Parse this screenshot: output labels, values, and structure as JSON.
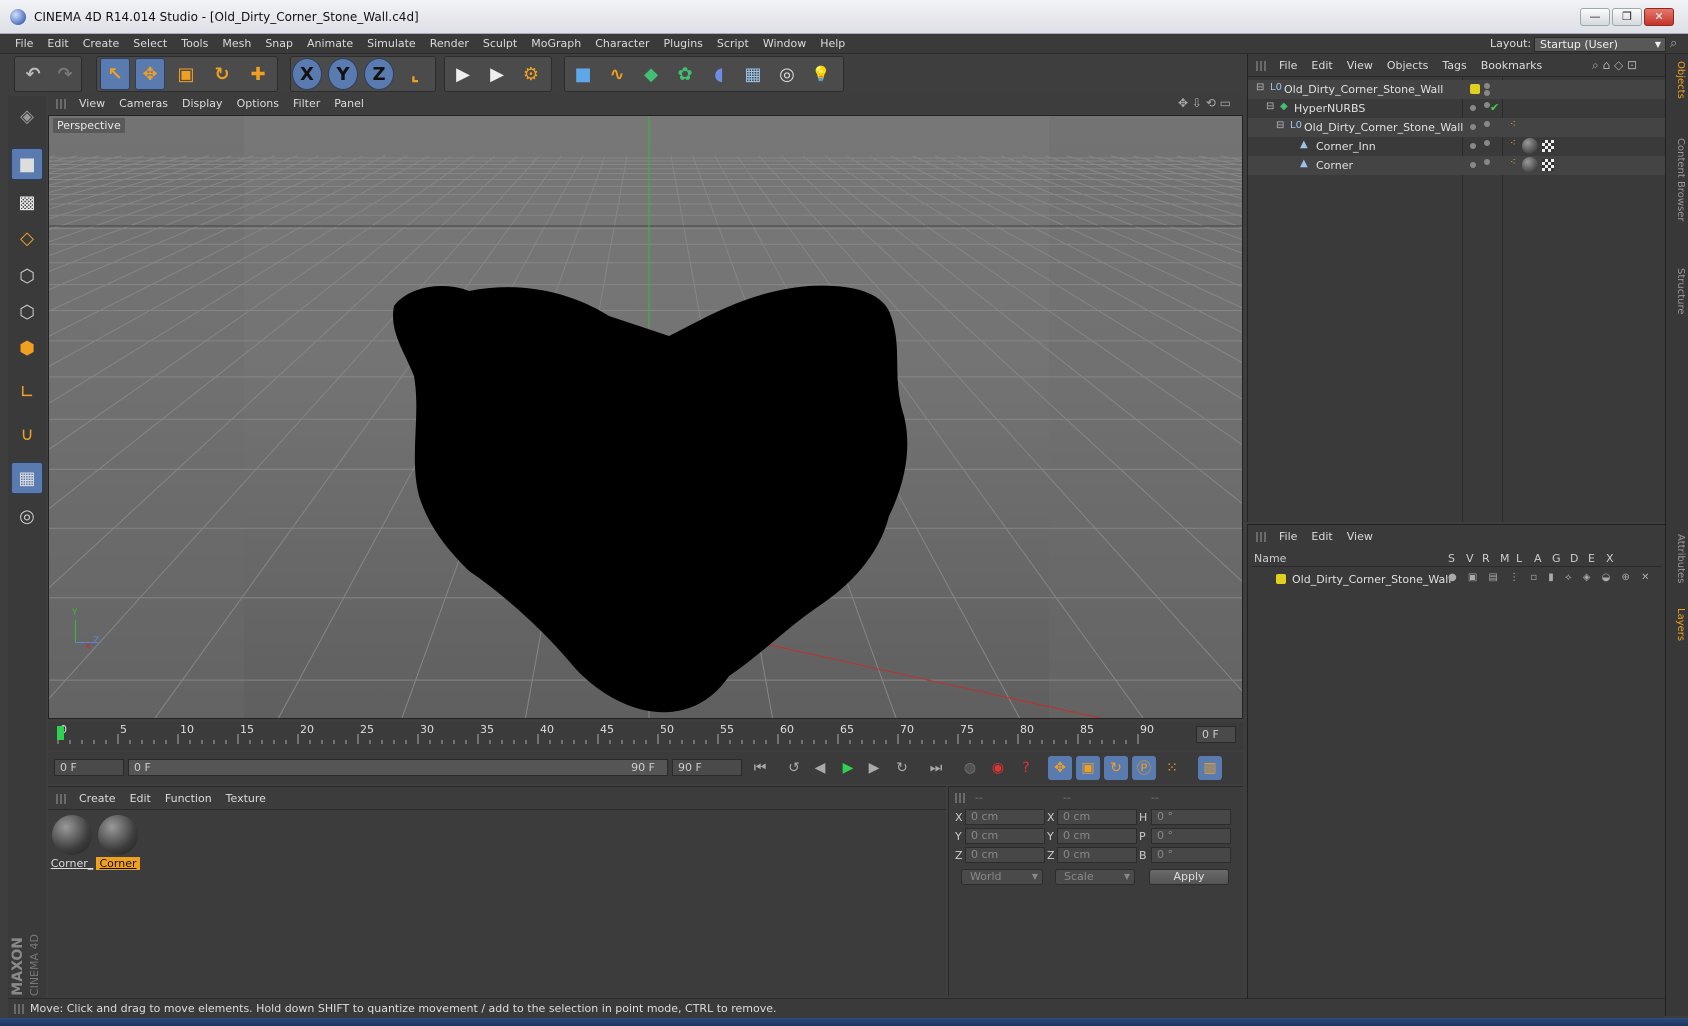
{
  "window": {
    "title": "CINEMA 4D R14.014 Studio - [Old_Dirty_Corner_Stone_Wall.c4d]",
    "minimize": "—",
    "restore": "❐",
    "close": "✕"
  },
  "menubar": {
    "items": [
      "File",
      "Edit",
      "Create",
      "Select",
      "Tools",
      "Mesh",
      "Snap",
      "Animate",
      "Simulate",
      "Render",
      "Sculpt",
      "MoGraph",
      "Character",
      "Plugins",
      "Script",
      "Window",
      "Help"
    ],
    "layout_label": "Layout:",
    "layout_value": "Startup (User)"
  },
  "toolbar": {
    "undo": "↶",
    "redo": "↷",
    "live_select": "↖",
    "move": "✥",
    "scale": "▣",
    "rotate": "↻",
    "add": "✚",
    "x_axis": "X",
    "y_axis": "Y",
    "z_axis": "Z",
    "coord_system": "⌞",
    "render_view": "▶",
    "render_pv": "▶",
    "render_settings": "⚙",
    "cube": "■",
    "spline": "∿",
    "nurbs": "◆",
    "array": "✿",
    "deformer": "◖",
    "scene": "▦",
    "camera": "◎",
    "light": "💡"
  },
  "viewport": {
    "menu": [
      "View",
      "Cameras",
      "Display",
      "Options",
      "Filter",
      "Panel"
    ],
    "camera_label": "Perspective",
    "axis_y": "Y",
    "axis_z": "Z",
    "axis_x": "X"
  },
  "timeline": {
    "ticks": [
      "0",
      "5",
      "10",
      "15",
      "20",
      "25",
      "30",
      "35",
      "40",
      "45",
      "50",
      "55",
      "60",
      "65",
      "70",
      "75",
      "80",
      "85",
      "90"
    ],
    "current_frame": "0 F",
    "start_frame": "0 F",
    "range_start": "0 F",
    "range_end": "90 F",
    "end_frame": "90 F"
  },
  "material_manager": {
    "menu": [
      "Create",
      "Edit",
      "Function",
      "Texture"
    ],
    "materials": [
      {
        "name": "Corner_",
        "selected": false
      },
      {
        "name": "Corner",
        "selected": true
      }
    ]
  },
  "coordinates": {
    "headers": [
      "--",
      "--",
      "--"
    ],
    "rows": [
      {
        "a": "X",
        "a_val": "0 cm",
        "b": "X",
        "b_val": "0 cm",
        "c": "H",
        "c_val": "0 °"
      },
      {
        "a": "Y",
        "a_val": "0 cm",
        "b": "Y",
        "b_val": "0 cm",
        "c": "P",
        "c_val": "0 °"
      },
      {
        "a": "Z",
        "a_val": "0 cm",
        "b": "Z",
        "b_val": "0 cm",
        "c": "B",
        "c_val": "0 °"
      }
    ],
    "mode1": "World",
    "mode2": "Scale",
    "apply": "Apply"
  },
  "object_manager": {
    "menu": [
      "File",
      "Edit",
      "View",
      "Objects",
      "Tags",
      "Bookmarks"
    ],
    "objects": [
      {
        "name": "Old_Dirty_Corner_Stone_Wall",
        "indent": 0,
        "icon": "L0"
      },
      {
        "name": "HyperNURBS",
        "indent": 1,
        "icon": "◆"
      },
      {
        "name": "Old_Dirty_Corner_Stone_Wall",
        "indent": 2,
        "icon": "L0"
      },
      {
        "name": "Corner_Inn",
        "indent": 3,
        "icon": "▲"
      },
      {
        "name": "Corner",
        "indent": 3,
        "icon": "▲"
      }
    ]
  },
  "layer_manager": {
    "menu": [
      "File",
      "Edit",
      "View"
    ],
    "columns": [
      "Name",
      "S",
      "V",
      "R",
      "M",
      "L",
      "A",
      "G",
      "D",
      "E",
      "X"
    ],
    "layers": [
      {
        "name": "Old_Dirty_Corner_Stone_Wall",
        "color": "#e0d020"
      }
    ]
  },
  "right_tabs": [
    "Objects",
    "Content Browser",
    "Structure",
    "Attributes",
    "Layers"
  ],
  "side_logo": {
    "line1": "MAXON",
    "line2": "CINEMA 4D"
  },
  "status_bar": "Move: Click and drag to move elements. Hold down SHIFT to quantize movement / add to the selection in point mode, CTRL to remove.",
  "colors": {
    "accent": "#f0a020",
    "active_tool": "#5a7bb0",
    "panel": "#3c3c3c",
    "viewport": "#747474",
    "y_axis": "#30c030",
    "x_axis": "#c03030"
  }
}
